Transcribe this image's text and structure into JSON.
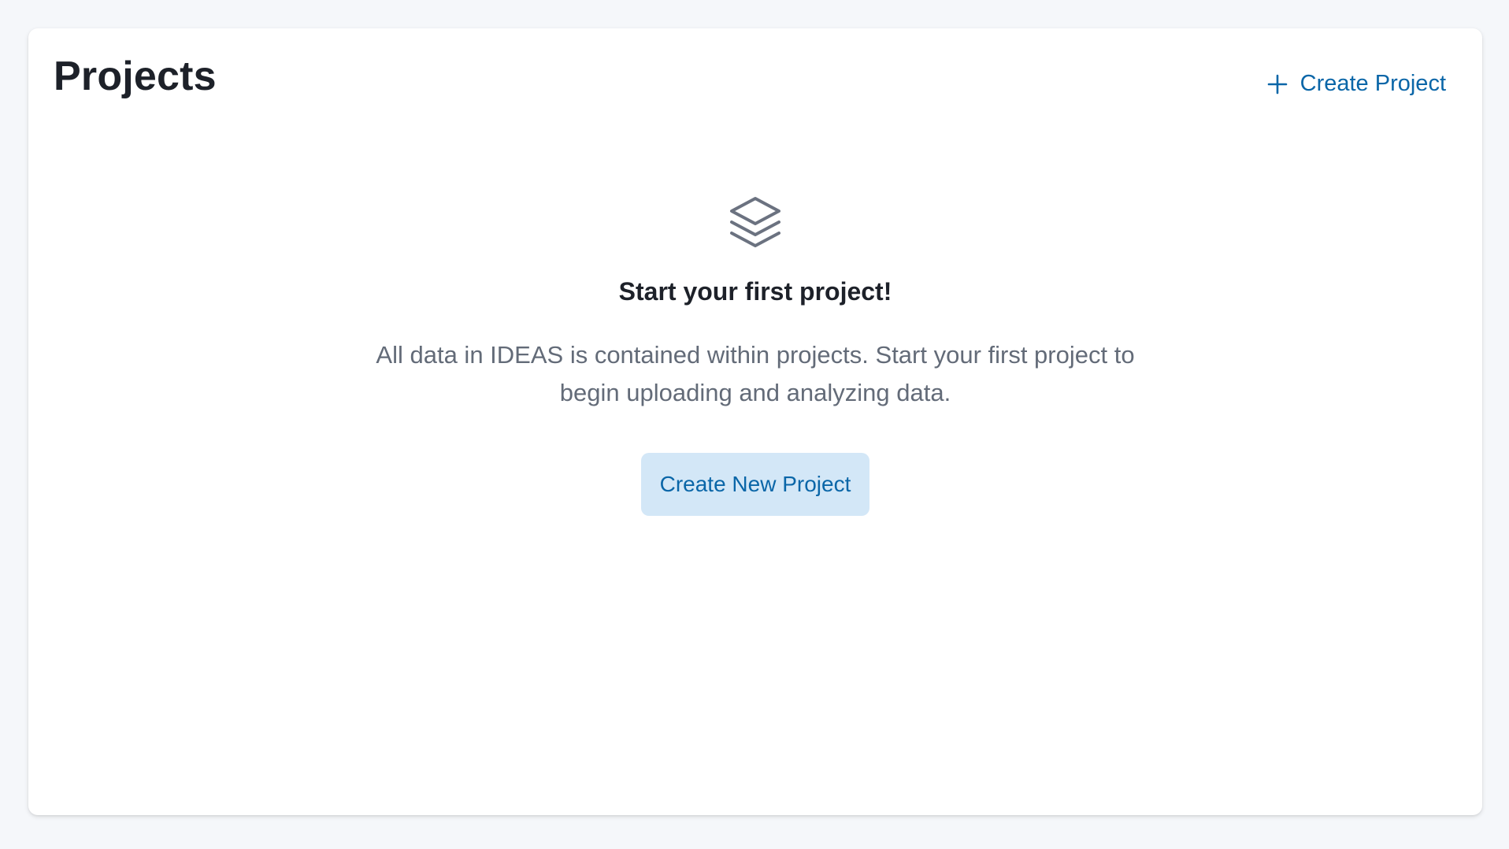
{
  "header": {
    "title": "Projects",
    "create_link_label": "Create Project",
    "create_link_icon": "plus-icon"
  },
  "empty_state": {
    "icon": "stack-icon",
    "heading": "Start your first project!",
    "description": "All data in IDEAS is contained within projects. Start your first project to begin uploading and analyzing data.",
    "button_label": "Create New Project"
  },
  "colors": {
    "accent": "#0a66a8",
    "button_bg": "#d3e7f7",
    "text_primary": "#1d2129",
    "text_secondary": "#636b78",
    "page_bg": "#f5f7fa"
  }
}
